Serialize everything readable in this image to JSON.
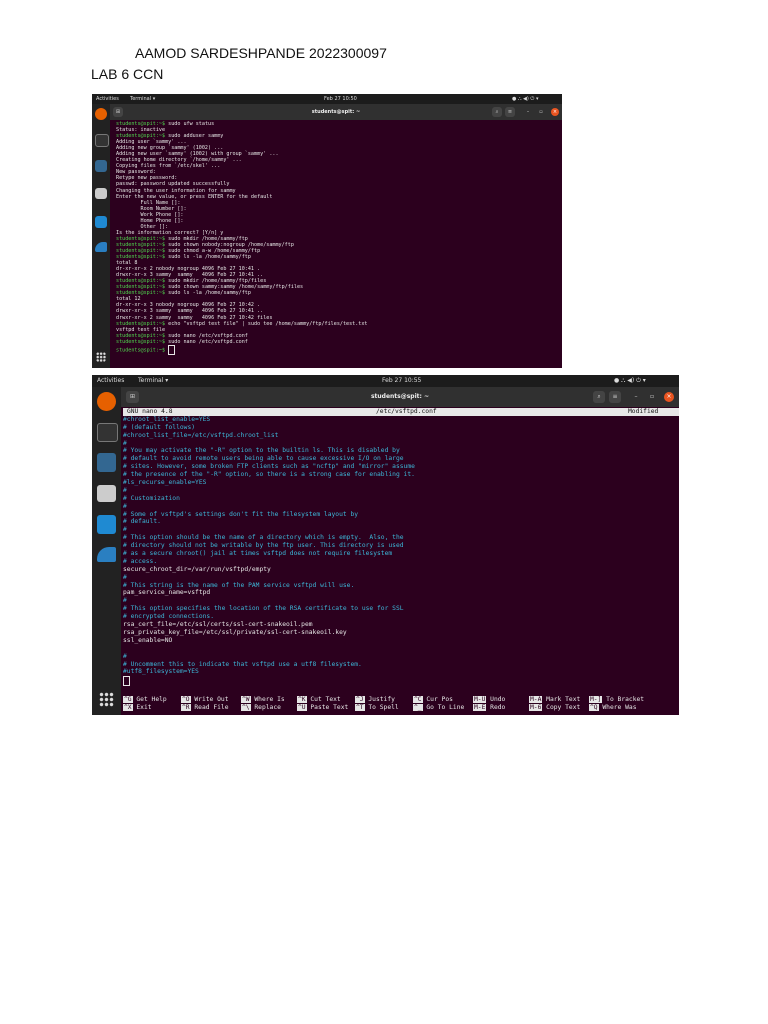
{
  "header": {
    "line1": "AAMOD SARDESHPANDE 2022300097",
    "line2": "LAB 6 CCN"
  },
  "shot1": {
    "topbar": {
      "activities": "Activities",
      "app": "Terminal ▾",
      "clock": "Feb 27 10:50"
    },
    "title": "students@spit: ~",
    "lines": [
      {
        "p": "students@spit:~$",
        "t": " sudo ufw status"
      },
      {
        "t": "Status: inactive"
      },
      {
        "p": "students@spit:~$",
        "t": " sudo adduser sammy"
      },
      {
        "t": "Adding user `sammy' ..."
      },
      {
        "t": "Adding new group `sammy' (1002) ..."
      },
      {
        "t": "Adding new user `sammy' (1002) with group `sammy' ..."
      },
      {
        "t": "Creating home directory `/home/sammy' ..."
      },
      {
        "t": "Copying files from `/etc/skel' ..."
      },
      {
        "t": "New password:"
      },
      {
        "t": "Retype new password:"
      },
      {
        "t": "passwd: password updated successfully"
      },
      {
        "t": "Changing the user information for sammy"
      },
      {
        "t": "Enter the new value, or press ENTER for the default"
      },
      {
        "t": "\tFull Name []:"
      },
      {
        "t": "\tRoom Number []:"
      },
      {
        "t": "\tWork Phone []:"
      },
      {
        "t": "\tHome Phone []:"
      },
      {
        "t": "\tOther []:"
      },
      {
        "t": "Is the information correct? [Y/n] y"
      },
      {
        "p": "students@spit:~$",
        "t": " sudo mkdir /home/sammy/ftp"
      },
      {
        "p": "students@spit:~$",
        "t": " sudo chown nobody:nogroup /home/sammy/ftp"
      },
      {
        "p": "students@spit:~$",
        "t": " sudo chmod a-w /home/sammy/ftp"
      },
      {
        "p": "students@spit:~$",
        "t": " sudo ls -la /home/sammy/ftp"
      },
      {
        "t": "total 8"
      },
      {
        "t": "dr-xr-xr-x 2 nobody nogroup 4096 Feb 27 10:41 ."
      },
      {
        "t": "drwxr-xr-x 3 sammy  sammy   4096 Feb 27 10:41 .."
      },
      {
        "p": "students@spit:~$",
        "t": " sudo mkdir /home/sammy/ftp/files"
      },
      {
        "p": "students@spit:~$",
        "t": " sudo chown sammy:sammy /home/sammy/ftp/files"
      },
      {
        "p": "students@spit:~$",
        "t": " sudo ls -la /home/sammy/ftp"
      },
      {
        "t": "total 12"
      },
      {
        "t": "dr-xr-xr-x 3 nobody nogroup 4096 Feb 27 10:42 ."
      },
      {
        "t": "drwxr-xr-x 3 sammy  sammy   4096 Feb 27 10:41 .."
      },
      {
        "t": "drwxr-xr-x 2 sammy  sammy   4096 Feb 27 10:42 files"
      },
      {
        "p": "students@spit:~$",
        "t": " echo \"vsftpd test file\" | sudo tee /home/sammy/ftp/files/test.txt"
      },
      {
        "t": "vsftpd test file"
      },
      {
        "p": "students@spit:~$",
        "t": " sudo nano /etc/vsftpd.conf"
      },
      {
        "p": "students@spit:~$",
        "t": " sudo nano /etc/vsftpd.conf"
      },
      {
        "p": "students@spit:~$",
        "t": " "
      }
    ]
  },
  "shot2": {
    "topbar": {
      "activities": "Activities",
      "app": "Terminal ▾",
      "clock": "Feb 27 10:55"
    },
    "title": "students@spit: ~",
    "nano": {
      "version": "GNU nano 4.8",
      "file": "/etc/vsftpd.conf",
      "status": "Modified"
    },
    "lines": [
      {
        "c": "#chroot_list_enable=YES"
      },
      {
        "c": "# (default follows)"
      },
      {
        "c": "#chroot_list_file=/etc/vsftpd.chroot_list"
      },
      {
        "c": "#"
      },
      {
        "c": "# You may activate the \"-R\" option to the builtin ls. This is disabled by"
      },
      {
        "c": "# default to avoid remote users being able to cause excessive I/O on large"
      },
      {
        "c": "# sites. However, some broken FTP clients such as \"ncftp\" and \"mirror\" assume"
      },
      {
        "c": "# the presence of the \"-R\" option, so there is a strong case for enabling it."
      },
      {
        "c": "#ls_recurse_enable=YES"
      },
      {
        "c": "#"
      },
      {
        "c": "# Customization"
      },
      {
        "c": "#"
      },
      {
        "c": "# Some of vsftpd's settings don't fit the filesystem layout by"
      },
      {
        "c": "# default."
      },
      {
        "c": "#"
      },
      {
        "c": "# This option should be the name of a directory which is empty.  Also, the"
      },
      {
        "c": "# directory should not be writable by the ftp user. This directory is used"
      },
      {
        "c": "# as a secure chroot() jail at times vsftpd does not require filesystem"
      },
      {
        "c": "# access."
      },
      {
        "t": "secure_chroot_dir=/var/run/vsftpd/empty"
      },
      {
        "c": "#"
      },
      {
        "c": "# This string is the name of the PAM service vsftpd will use."
      },
      {
        "t": "pam_service_name=vsftpd"
      },
      {
        "c": "#"
      },
      {
        "c": "# This option specifies the location of the RSA certificate to use for SSL"
      },
      {
        "c": "# encrypted connections."
      },
      {
        "t": "rsa_cert_file=/etc/ssl/certs/ssl-cert-snakeoil.pem"
      },
      {
        "t": "rsa_private_key_file=/etc/ssl/private/ssl-cert-snakeoil.key"
      },
      {
        "t": "ssl_enable=NO"
      },
      {
        "t": ""
      },
      {
        "c": "#"
      },
      {
        "c": "# Uncomment this to indicate that vsftpd use a utf8 filesystem."
      },
      {
        "c": "#utf8_filesystem=YES"
      }
    ],
    "keys": [
      {
        "k1": "^G",
        "l1": "Get Help",
        "k2": "^X",
        "l2": "Exit"
      },
      {
        "k1": "^O",
        "l1": "Write Out",
        "k2": "^R",
        "l2": "Read File"
      },
      {
        "k1": "^W",
        "l1": "Where Is",
        "k2": "^\\",
        "l2": "Replace"
      },
      {
        "k1": "^K",
        "l1": "Cut Text",
        "k2": "^U",
        "l2": "Paste Text"
      },
      {
        "k1": "^J",
        "l1": "Justify",
        "k2": "^T",
        "l2": "To Spell"
      },
      {
        "k1": "^C",
        "l1": "Cur Pos",
        "k2": "^_",
        "l2": "Go To Line"
      },
      {
        "k1": "M-U",
        "l1": "Undo",
        "k2": "M-E",
        "l2": "Redo"
      },
      {
        "k1": "M-A",
        "l1": "Mark Text",
        "k2": "M-6",
        "l2": "Copy Text"
      },
      {
        "k1": "M-]",
        "l1": "To Bracket",
        "k2": "^Q",
        "l2": "Where Was"
      }
    ]
  }
}
